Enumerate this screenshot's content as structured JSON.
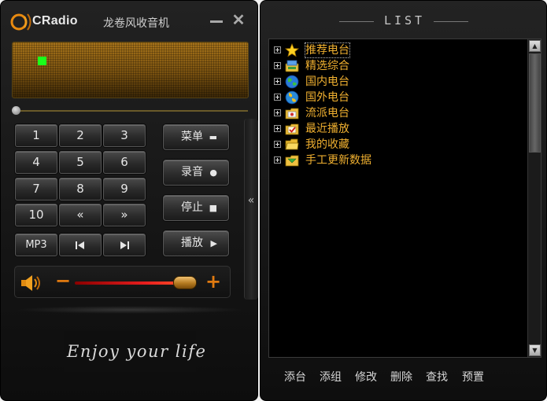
{
  "app": {
    "logo_text": "CRadio",
    "title": "龙卷风收音机",
    "minimize_label": "",
    "close_label": "✕"
  },
  "keypad": {
    "k1": "1",
    "k2": "2",
    "k3": "3",
    "k4": "4",
    "k5": "5",
    "k6": "6",
    "k7": "7",
    "k8": "8",
    "k9": "9",
    "k10": "10",
    "prev_page": "«",
    "next_page": "»",
    "mp3": "MP3"
  },
  "functions": {
    "menu_label": "菜单",
    "record_label": "录音",
    "stop_label": "停止",
    "play_label": "播放"
  },
  "volume": {
    "minus": "−",
    "plus": "+",
    "level": 0.92
  },
  "slogan": "Enjoy your life",
  "list": {
    "title": "LIST",
    "items": [
      {
        "label": "推荐电台",
        "icon": "star-icon"
      },
      {
        "label": "精选综合",
        "icon": "radio-tray-icon"
      },
      {
        "label": "国内电台",
        "icon": "globe-icon"
      },
      {
        "label": "国外电台",
        "icon": "globe-icon"
      },
      {
        "label": "流派电台",
        "icon": "music-folder-icon"
      },
      {
        "label": "最近播放",
        "icon": "checked-folder-icon"
      },
      {
        "label": "我的收藏",
        "icon": "folder-icon"
      },
      {
        "label": "手工更新数据",
        "icon": "update-folder-icon"
      }
    ],
    "selected_index": 0
  },
  "actions": {
    "add_station": "添台",
    "add_group": "添组",
    "edit": "修改",
    "delete": "删除",
    "find": "查找",
    "preset": "预置"
  },
  "colors": {
    "accent_orange": "#f0b030",
    "display_amber": "#a8741a",
    "signal_green": "#1aff1a"
  }
}
